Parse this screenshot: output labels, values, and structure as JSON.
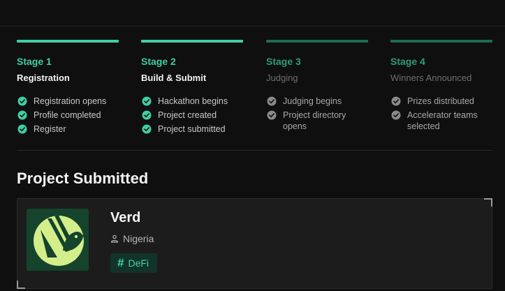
{
  "stages": [
    {
      "number": "Stage 1",
      "name": "Registration",
      "active": true,
      "items": [
        "Registration opens",
        "Profile completed",
        "Register"
      ]
    },
    {
      "number": "Stage 2",
      "name": "Build & Submit",
      "active": true,
      "items": [
        "Hackathon begins",
        "Project created",
        "Project submitted"
      ]
    },
    {
      "number": "Stage 3",
      "name": "Judging",
      "active": false,
      "items": [
        "Judging begins",
        "Project directory opens"
      ]
    },
    {
      "number": "Stage 4",
      "name": "Winners Announced",
      "active": false,
      "items": [
        "Prizes distributed",
        "Accelerator teams selected"
      ]
    }
  ],
  "section": {
    "title": "Project Submitted"
  },
  "project": {
    "name": "Verd",
    "location": "Nigeria",
    "tag": "DeFi"
  },
  "colors": {
    "active_bar": "#3fcfa4",
    "inactive_bar": "#1d6b55",
    "active_number": "#3fcfa4",
    "inactive_number": "#2f9b7a",
    "check_active": "#3fcfa4",
    "check_inactive": "#8a8a8a"
  }
}
